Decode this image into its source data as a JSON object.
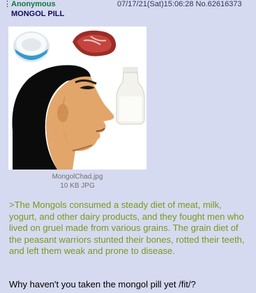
{
  "post": {
    "name": "Anonymous",
    "datetime": "07/17/21(Sat)15:06:28",
    "post_no": "No.62616373",
    "subject": "MONGOL PILL",
    "file": {
      "filename": "MongolChad.jpg",
      "meta": "10 KB JPG"
    },
    "greentext": ">The Mongols consumed a steady diet of meat, milk, yogurt, and other dairy products, and they fought men who lived on gruel made from various grains. The grain diet of the peasant warriors stunted their bones, rotted their teeth, and left them weak and prone to disease.",
    "message": "Why haven't you taken the mongol pill yet /fit/?"
  },
  "colors": {
    "background": "#d6daf0",
    "name": "#117743",
    "subject": "#0f0c5d",
    "greentext": "#789922"
  },
  "icons": {
    "menu": "vertical-ellipsis-icon"
  }
}
